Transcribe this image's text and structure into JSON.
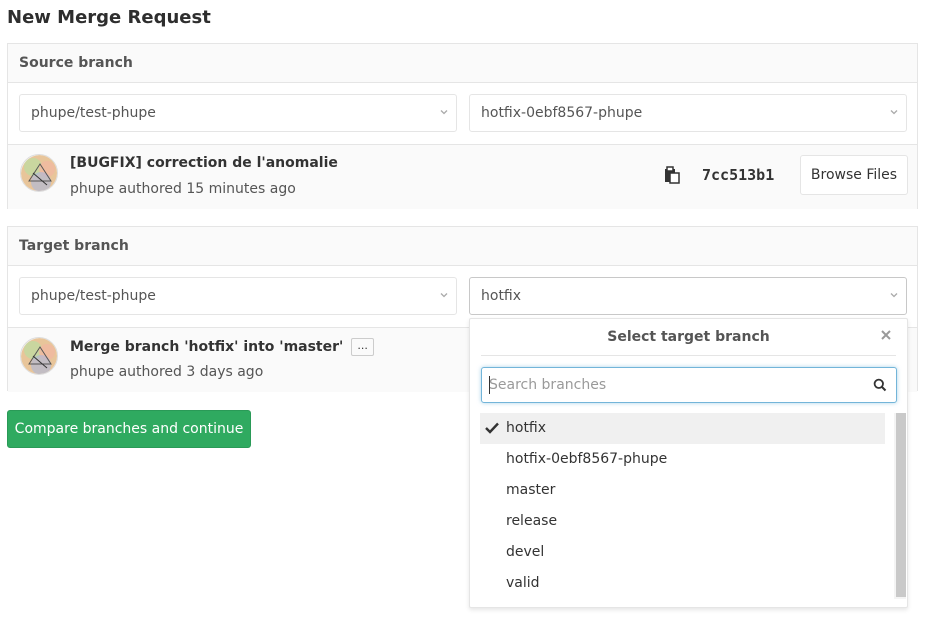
{
  "page": {
    "title": "New Merge Request"
  },
  "source": {
    "header": "Source branch",
    "project_select": "phupe/test-phupe",
    "branch_select": "hotfix-0ebf8567-phupe",
    "commit": {
      "title": "[BUGFIX] correction de l'anomalie",
      "author": "phupe",
      "meta_suffix": "authored 15 minutes ago",
      "sha": "7cc513b1",
      "browse_label": "Browse Files"
    }
  },
  "target": {
    "header": "Target branch",
    "project_select": "phupe/test-phupe",
    "branch_select": "hotfix",
    "commit": {
      "title": "Merge branch 'hotfix' into 'master'",
      "ellipsis": "...",
      "author": "phupe",
      "meta_suffix": "authored 3 days ago"
    }
  },
  "compare_button": "Compare branches and continue",
  "dropdown": {
    "title": "Select target branch",
    "search_placeholder": "Search branches",
    "selected": "hotfix",
    "branches": [
      "hotfix",
      "hotfix-0ebf8567-phupe",
      "master",
      "release",
      "devel",
      "valid"
    ]
  },
  "colors": {
    "primary_green": "#2faa60",
    "focus_blue": "#73b5d9",
    "panel_bg": "#fafafa",
    "border": "#e5e5e5"
  },
  "icons": [
    "chevron-down-icon",
    "copy-icon",
    "close-icon",
    "search-icon",
    "check-icon",
    "avatar"
  ]
}
